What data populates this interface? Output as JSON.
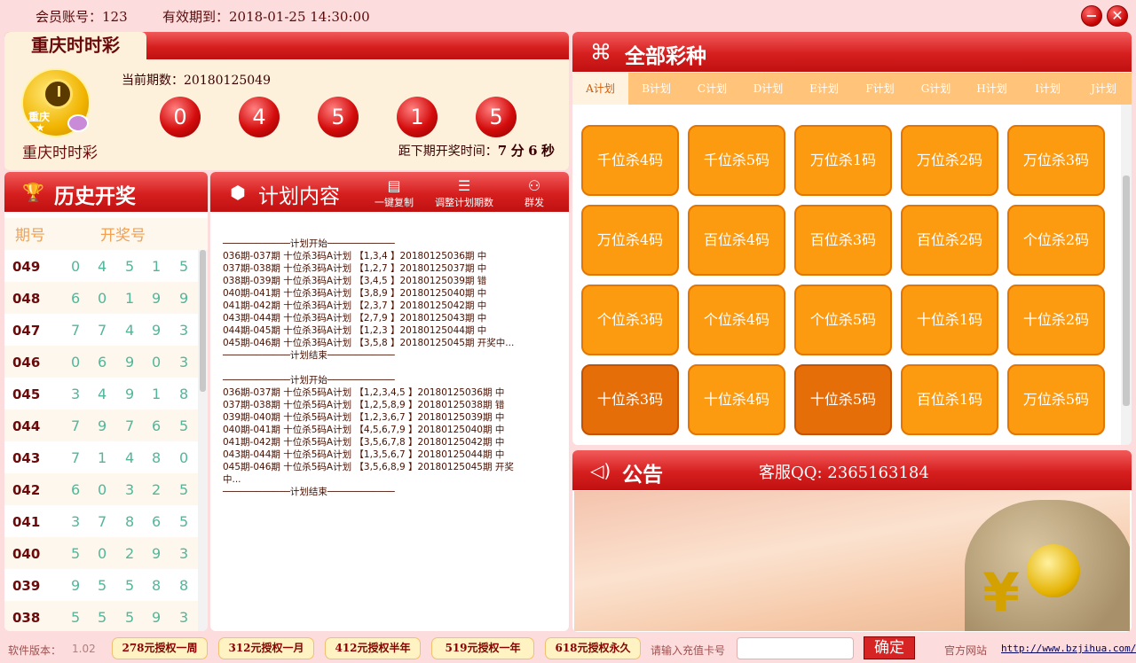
{
  "window": {
    "account_label": "会员账号：123",
    "expiry_label": "有效期到：2018-01-25 14:30:00",
    "min_icon": "minimize-icon",
    "close_icon": "close-icon"
  },
  "lottery": {
    "tab_title": "重庆时时彩",
    "logo_text": "重庆",
    "name": "重庆时时彩",
    "current_period": "当前期数：20180125049",
    "balls": [
      "0",
      "4",
      "5",
      "1",
      "5"
    ],
    "countdown_prefix": "距下期开奖时间：",
    "minutes": "7",
    "minutes_unit": "分",
    "seconds": "6",
    "seconds_unit": "秒"
  },
  "history": {
    "title": "历史开奖",
    "col_period": "期号",
    "col_numbers": "开奖号",
    "rows": [
      {
        "p": "049",
        "n": [
          "0",
          "4",
          "5",
          "1",
          "5"
        ]
      },
      {
        "p": "048",
        "n": [
          "6",
          "0",
          "1",
          "9",
          "9"
        ]
      },
      {
        "p": "047",
        "n": [
          "7",
          "7",
          "4",
          "9",
          "3"
        ]
      },
      {
        "p": "046",
        "n": [
          "0",
          "6",
          "9",
          "0",
          "3"
        ]
      },
      {
        "p": "045",
        "n": [
          "3",
          "4",
          "9",
          "1",
          "8"
        ]
      },
      {
        "p": "044",
        "n": [
          "7",
          "9",
          "7",
          "6",
          "5"
        ]
      },
      {
        "p": "043",
        "n": [
          "7",
          "1",
          "4",
          "8",
          "0"
        ]
      },
      {
        "p": "042",
        "n": [
          "6",
          "0",
          "3",
          "2",
          "5"
        ]
      },
      {
        "p": "041",
        "n": [
          "3",
          "7",
          "8",
          "6",
          "5"
        ]
      },
      {
        "p": "040",
        "n": [
          "5",
          "0",
          "2",
          "9",
          "3"
        ]
      },
      {
        "p": "039",
        "n": [
          "9",
          "5",
          "5",
          "8",
          "8"
        ]
      },
      {
        "p": "038",
        "n": [
          "5",
          "5",
          "5",
          "9",
          "3"
        ]
      }
    ]
  },
  "plan": {
    "title": "计划内容",
    "copy_label": "一键复制",
    "adjust_label": "调整计划期数",
    "mass_label": "群发",
    "lines": [
      "────────────计划开始────────────",
      "036期-037期 十位杀3码A计划 【1,3,4 】20180125036期 中",
      "037期-038期 十位杀3码A计划 【1,2,7 】20180125037期 中",
      "038期-039期 十位杀3码A计划 【3,4,5 】20180125039期 错",
      "040期-041期 十位杀3码A计划 【3,8,9 】20180125040期 中",
      "041期-042期 十位杀3码A计划 【2,3,7 】20180125042期 中",
      "043期-044期 十位杀3码A计划 【2,7,9 】20180125043期 中",
      "044期-045期 十位杀3码A计划 【1,2,3 】20180125044期 中",
      "045期-046期 十位杀3码A计划 【3,5,8 】20180125045期 开奖中...",
      "────────────计划结束────────────",
      "",
      "────────────计划开始────────────",
      "036期-037期 十位杀5码A计划 【1,2,3,4,5 】20180125036期 中",
      "037期-038期 十位杀5码A计划 【1,2,5,8,9 】20180125038期 错",
      "039期-040期 十位杀5码A计划 【1,2,3,6,7 】20180125039期 中",
      "040期-041期 十位杀5码A计划 【4,5,6,7,9 】20180125040期 中",
      "041期-042期 十位杀5码A计划 【3,5,6,7,8 】20180125042期 中",
      "043期-044期 十位杀5码A计划 【1,3,5,6,7 】20180125044期 中",
      "045期-046期 十位杀5码A计划 【3,5,6,8,9 】20180125045期 开奖",
      "中...",
      "────────────计划结束────────────"
    ]
  },
  "all_types": {
    "title": "全部彩种",
    "tabs": [
      "A计划",
      "B计划",
      "C计划",
      "D计划",
      "E计划",
      "F计划",
      "G计划",
      "H计划",
      "I计划",
      "J计划"
    ],
    "active_tab": 0,
    "buttons": [
      "千位杀4码",
      "千位杀5码",
      "万位杀1码",
      "万位杀2码",
      "万位杀3码",
      "万位杀4码",
      "百位杀4码",
      "百位杀3码",
      "百位杀2码",
      "个位杀2码",
      "个位杀3码",
      "个位杀4码",
      "个位杀5码",
      "十位杀1码",
      "十位杀2码",
      "十位杀3码",
      "十位杀4码",
      "十位杀5码",
      "百位杀1码",
      "万位杀5码"
    ],
    "selected": [
      15,
      17
    ]
  },
  "notice": {
    "title": "公告",
    "qq": "客服QQ: 2365163184"
  },
  "bottom": {
    "version_label": "软件版本：",
    "version": "1.02",
    "licenses": [
      "278元授权一周",
      "312元授权一月",
      "412元授权半年",
      "519元授权一年",
      "618元授权永久"
    ],
    "card_placeholder": "请输入充值卡号",
    "ok_label": "确定",
    "site_label": "官方网站",
    "url": "http://www.bzjihua.com/"
  },
  "colors": {
    "header_red": "#d61f1f",
    "button_orange": "#fc9b10",
    "number_green": "#52b69a"
  }
}
